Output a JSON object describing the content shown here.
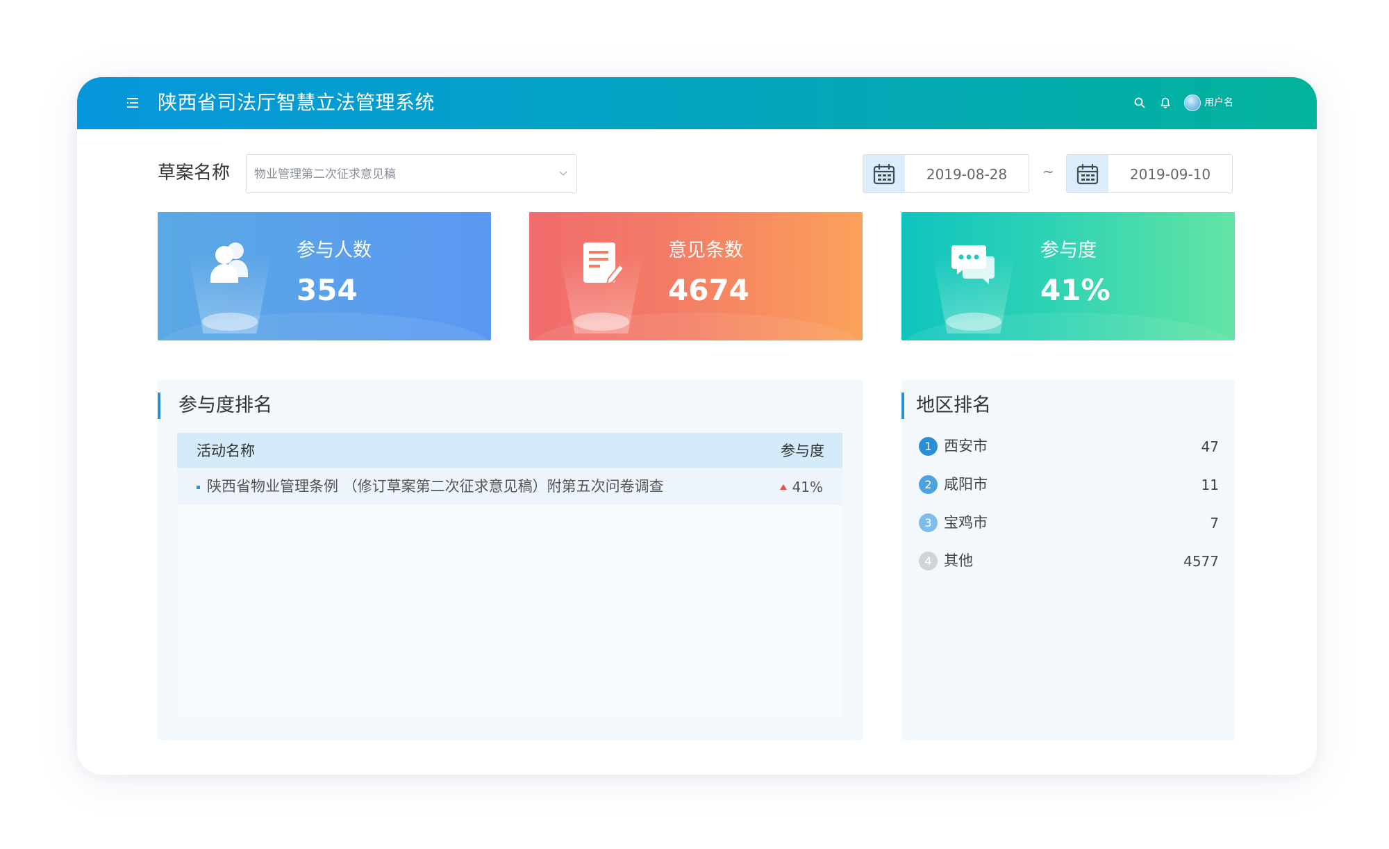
{
  "header": {
    "title": "陕西省司法厅智慧立法管理系统",
    "username": "用户名",
    "icons": [
      "menu-icon",
      "search-icon",
      "bell-icon",
      "avatar"
    ]
  },
  "filter": {
    "draft_label": "草案名称",
    "draft_value": "物业管理第二次征求意见稿",
    "start_date": "2019-08-28",
    "end_date": "2019-09-10",
    "separator": "~"
  },
  "stats": [
    {
      "label": "参与人数",
      "value": "354",
      "icon": "users-icon",
      "color": "#5b9cf0"
    },
    {
      "label": "意见条数",
      "value": "4674",
      "icon": "document-edit-icon",
      "color": "#f47d66"
    },
    {
      "label": "参与度",
      "value": "41%",
      "icon": "chat-bubbles-icon",
      "color": "#2ed3b4"
    }
  ],
  "participation_ranking": {
    "title": "参与度排名",
    "columns": {
      "name": "活动名称",
      "rate": "参与度"
    },
    "rows": [
      {
        "name": "陕西省物业管理条例 （修订草案第二次征求意见稿）附第五次问卷调查",
        "rate": "41%",
        "trend": "up"
      }
    ]
  },
  "region_ranking": {
    "title": "地区排名",
    "items": [
      {
        "rank": "1",
        "name": "西安市",
        "count": "47",
        "badge_color": "#2a8ed6"
      },
      {
        "rank": "2",
        "name": "咸阳市",
        "count": "11",
        "badge_color": "#4ca3e0"
      },
      {
        "rank": "3",
        "name": "宝鸡市",
        "count": "7",
        "badge_color": "#7fbde9"
      },
      {
        "rank": "4",
        "name": "其他",
        "count": "4577",
        "badge_color": "#cfd4da"
      }
    ]
  },
  "colors": {
    "header_start": "#0696dc",
    "header_end": "#02b39c",
    "accent": "#2a8ed6",
    "trend_up": "#e8504a"
  }
}
